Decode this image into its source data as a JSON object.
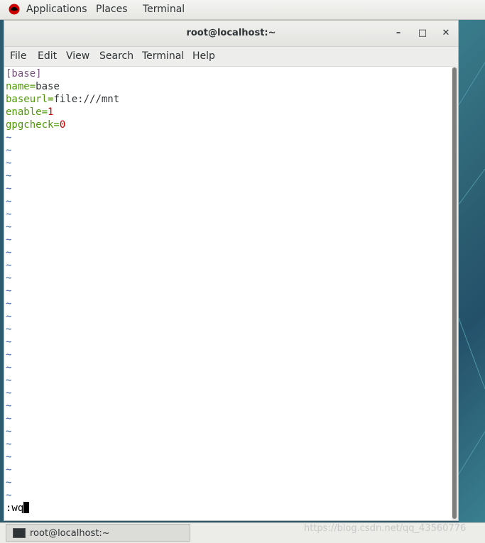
{
  "topbar": {
    "applications": "Applications",
    "places": "Places",
    "terminal": "Terminal"
  },
  "window": {
    "title": "root@localhost:~",
    "minimize": "–",
    "maximize": "□",
    "close": "✕"
  },
  "menubar": [
    "File",
    "Edit",
    "View",
    "Search",
    "Terminal",
    "Help"
  ],
  "editor": {
    "section": "[base]",
    "l1_key": "name=",
    "l1_val": "base",
    "l2_key": "baseurl=",
    "l2_val": "file:///mnt",
    "l3_key": "enable=",
    "l3_val": "1",
    "l4_key": "gpgcheck=",
    "l4_val": "0",
    "tilde": "~",
    "command": ":wq"
  },
  "taskbar": {
    "task_label": "root@localhost:~"
  },
  "watermark": "https://blog.csdn.net/qq_43560776"
}
